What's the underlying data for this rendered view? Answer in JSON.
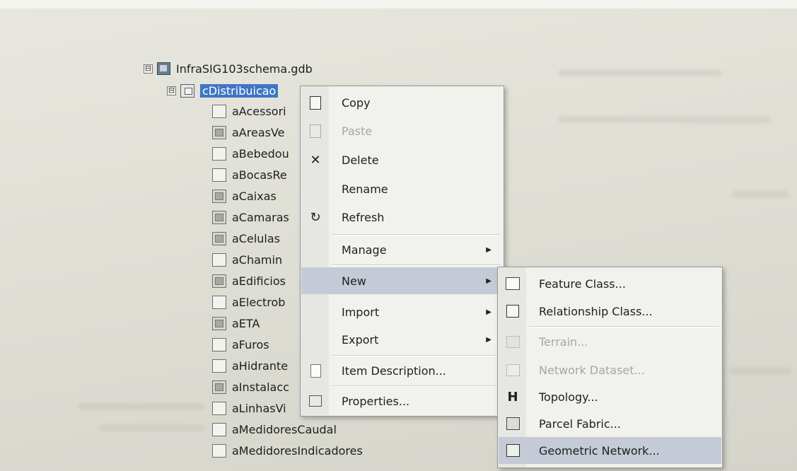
{
  "tree": {
    "root": {
      "label": "InfraSIG103schema.gdb",
      "icon": "file-geodatabase-icon",
      "expander": "⊟"
    },
    "dataset": {
      "label": "cDistribuicao",
      "icon": "feature-dataset-icon",
      "expander": "⊟"
    },
    "children": [
      {
        "label": "aAcessori",
        "icon": "point-feature-class-icon"
      },
      {
        "label": "aAreasVe",
        "icon": "polygon-feature-class-icon"
      },
      {
        "label": "aBebedou",
        "icon": "point-feature-class-icon"
      },
      {
        "label": "aBocasRe",
        "icon": "point-feature-class-icon"
      },
      {
        "label": "aCaixas",
        "icon": "polygon-feature-class-icon"
      },
      {
        "label": "aCamaras",
        "icon": "polygon-feature-class-icon"
      },
      {
        "label": "aCelulas",
        "icon": "polygon-feature-class-icon"
      },
      {
        "label": "aChamin",
        "icon": "point-feature-class-icon"
      },
      {
        "label": "aEdificios",
        "icon": "polygon-feature-class-icon"
      },
      {
        "label": "aElectrob",
        "icon": "point-feature-class-icon"
      },
      {
        "label": "aETA",
        "icon": "polygon-feature-class-icon"
      },
      {
        "label": "aFuros",
        "icon": "point-feature-class-icon"
      },
      {
        "label": "aHidrante",
        "icon": "point-feature-class-icon"
      },
      {
        "label": "aInstalacc",
        "icon": "polygon-feature-class-icon"
      },
      {
        "label": "aLinhasVi",
        "icon": "line-feature-class-icon"
      },
      {
        "label": "aMedidoresCaudal",
        "icon": "point-feature-class-icon"
      },
      {
        "label": "aMedidoresIndicadores",
        "icon": "point-feature-class-icon"
      }
    ]
  },
  "context_menu": {
    "items": [
      {
        "label": "Copy",
        "icon": "copy-icon",
        "enabled": true
      },
      {
        "label": "Paste",
        "icon": "paste-icon",
        "enabled": false
      },
      {
        "label": "Delete",
        "icon": "delete-icon",
        "glyph": "✕",
        "enabled": true
      },
      {
        "label": "Rename",
        "enabled": true
      },
      {
        "label": "Refresh",
        "icon": "refresh-icon",
        "glyph": "↻",
        "enabled": true
      },
      {
        "label": "Manage",
        "submenu": true
      },
      {
        "label": "New",
        "submenu": true,
        "highlighted": true
      },
      {
        "label": "Import",
        "submenu": true
      },
      {
        "label": "Export",
        "submenu": true
      },
      {
        "label": "Item Description...",
        "icon": "item-description-icon"
      },
      {
        "label": "Properties...",
        "icon": "properties-icon"
      }
    ],
    "arrow_glyph": "▶"
  },
  "new_submenu": {
    "items": [
      {
        "label": "Feature Class...",
        "icon": "feature-class-icon",
        "enabled": true
      },
      {
        "label": "Relationship Class...",
        "icon": "relationship-class-icon",
        "enabled": true
      },
      {
        "label": "Terrain...",
        "icon": "terrain-icon",
        "enabled": false
      },
      {
        "label": "Network Dataset...",
        "icon": "network-dataset-icon",
        "enabled": false
      },
      {
        "label": "Topology...",
        "icon": "topology-icon",
        "glyph": "H",
        "enabled": true
      },
      {
        "label": "Parcel Fabric...",
        "icon": "parcel-fabric-icon",
        "enabled": true
      },
      {
        "label": "Geometric Network...",
        "icon": "geometric-network-icon",
        "enabled": true,
        "highlighted": true
      }
    ]
  },
  "colors": {
    "selection": "#3f75c4",
    "menu_bg": "#f1f1ee",
    "highlight": "#c4cbd6",
    "disabled_text": "#a7a7a2"
  }
}
